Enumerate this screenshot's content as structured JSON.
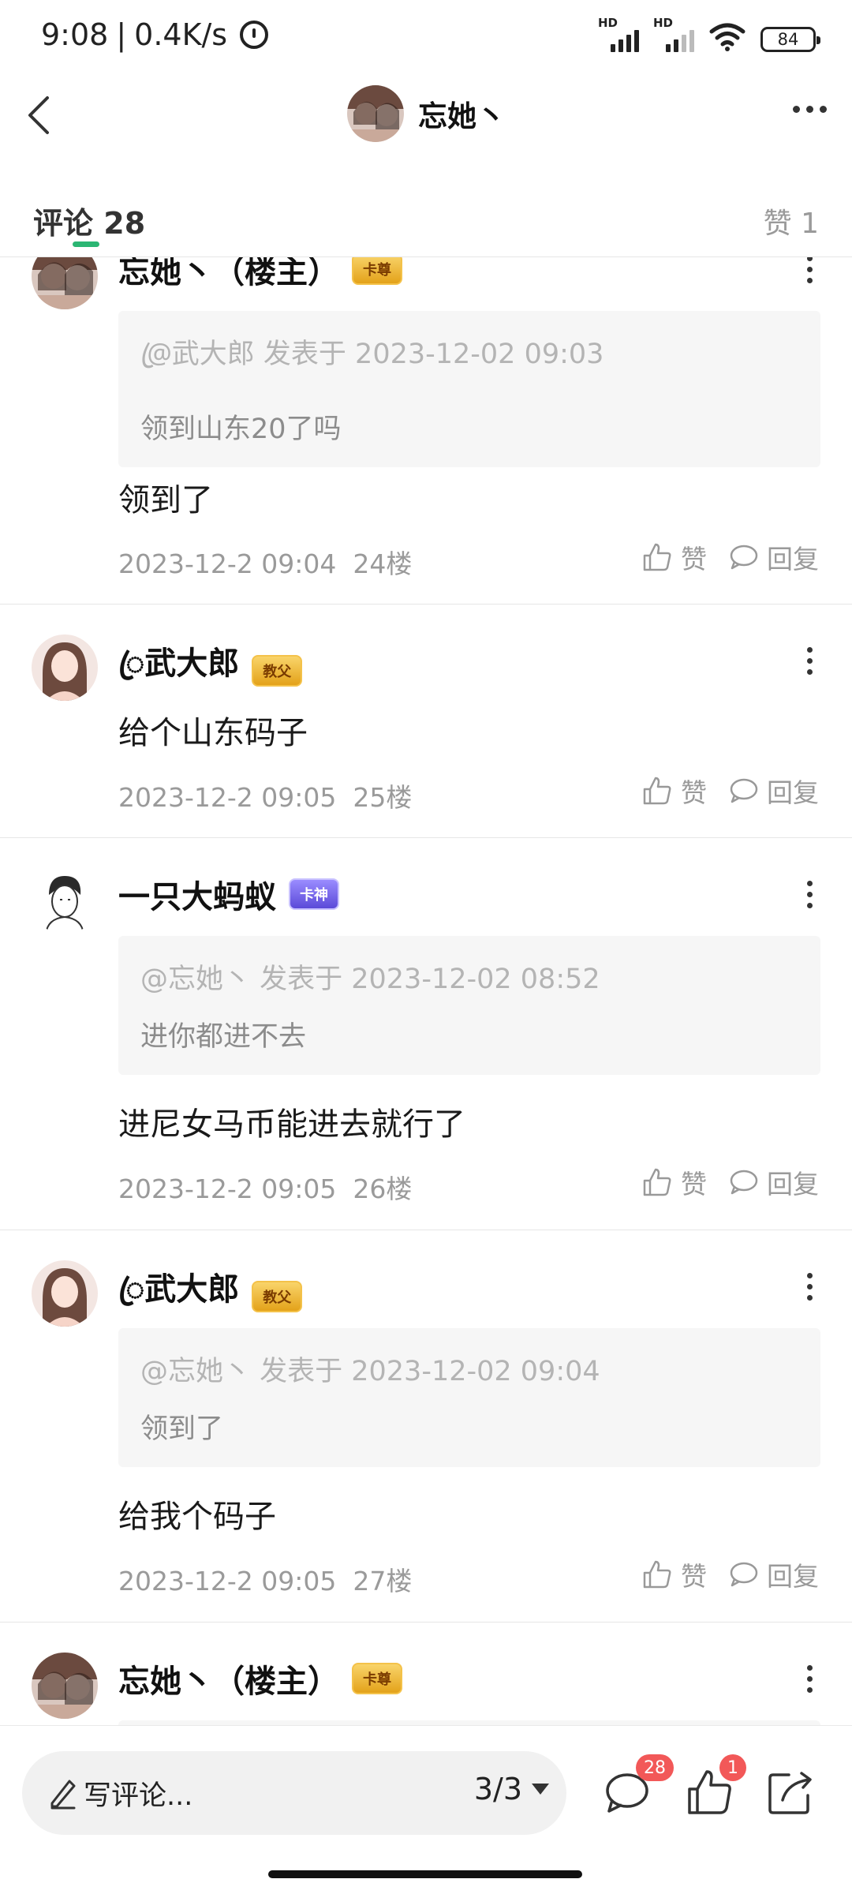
{
  "status_bar": {
    "time": "9:08",
    "network_speed": "0.4K/s",
    "signal_1_label": "HD",
    "signal_2_label": "HD",
    "battery": "84",
    "icons": [
      "alarm-icon",
      "signal-icon",
      "wifi-icon",
      "battery-icon"
    ]
  },
  "header": {
    "title": "忘她丶",
    "back_icon": "chevron-left-icon",
    "more_icon": "more-horizontal-icon"
  },
  "tabs": {
    "comments_label": "评论",
    "comments_count": "28",
    "likes_label": "赞 1"
  },
  "comments": [
    {
      "author": "忘她丶（楼主）",
      "badge": "卡尊",
      "badge_style": "gold",
      "quote_meta": "@ꦿ武大郎 发表于 2023-12-02 09:03",
      "quote_text": "领到山东20了吗",
      "text": "领到了",
      "date": "2023-12-2 09:04",
      "floor": "24楼",
      "like_label": "赞",
      "reply_label": "回复"
    },
    {
      "author": "ꦿ武大郎",
      "badge": "教父",
      "badge_style": "gold",
      "quote_meta": "",
      "quote_text": "",
      "text": "给个山东码子",
      "date": "2023-12-2 09:05",
      "floor": "25楼",
      "like_label": "赞",
      "reply_label": "回复"
    },
    {
      "author": "一只大蚂蚁",
      "badge": "卡神",
      "badge_style": "purple",
      "quote_meta": "@忘她丶 发表于 2023-12-02 08:52",
      "quote_text": "进你都进不去",
      "text": "进尼女马币能进去就行了",
      "date": "2023-12-2 09:05",
      "floor": "26楼",
      "like_label": "赞",
      "reply_label": "回复"
    },
    {
      "author": "ꦿ武大郎",
      "badge": "教父",
      "badge_style": "gold",
      "quote_meta": "@忘她丶 发表于 2023-12-02 09:04",
      "quote_text": "领到了",
      "text": "给我个码子",
      "date": "2023-12-2 09:05",
      "floor": "27楼",
      "like_label": "赞",
      "reply_label": "回复"
    },
    {
      "author": "忘她丶（楼主）",
      "badge": "卡尊",
      "badge_style": "gold"
    }
  ],
  "bottom_bar": {
    "comment_placeholder": "写评论...",
    "page_indicator": "3/3",
    "comment_count_badge": "28",
    "like_count_badge": "1",
    "icons": [
      "pen-icon",
      "comment-icon",
      "thumbs-up-icon",
      "share-icon"
    ]
  },
  "colors": {
    "accent": "#2bb673",
    "badge_red": "#f25858",
    "secondary_text": "#9a9a9a",
    "quote_bg": "#f6f6f6"
  }
}
